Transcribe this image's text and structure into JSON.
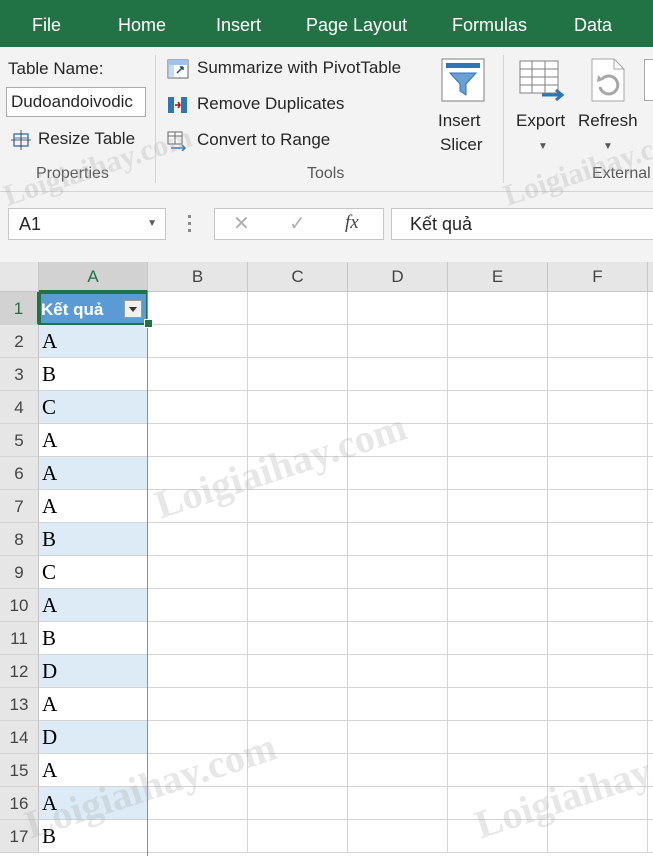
{
  "tabs": [
    "File",
    "Home",
    "Insert",
    "Page Layout",
    "Formulas",
    "Data"
  ],
  "ribbon": {
    "properties": {
      "table_name_label": "Table Name:",
      "table_name_value": "Dudoandoivodic",
      "resize_table": "Resize Table",
      "group_label": "Properties"
    },
    "tools": {
      "summarize": "Summarize with PivotTable",
      "remove_duplicates": "Remove Duplicates",
      "convert_to_range": "Convert to Range",
      "insert_slicer_line1": "Insert",
      "insert_slicer_line2": "Slicer",
      "group_label": "Tools"
    },
    "external": {
      "export": "Export",
      "refresh": "Refresh",
      "group_label": "External"
    }
  },
  "formula_bar": {
    "name_box": "A1",
    "cancel": "✕",
    "enter": "✓",
    "fx": "fx",
    "content": "Kết quả"
  },
  "columns": [
    "A",
    "B",
    "C",
    "D",
    "E",
    "F"
  ],
  "rows": [
    "1",
    "2",
    "3",
    "4",
    "5",
    "6",
    "7",
    "8",
    "9",
    "10",
    "11",
    "12",
    "13",
    "14",
    "15",
    "16",
    "17"
  ],
  "table": {
    "header": "Kết quả",
    "values": [
      "A",
      "B",
      "C",
      "A",
      "A",
      "A",
      "B",
      "C",
      "A",
      "B",
      "D",
      "A",
      "D",
      "A",
      "A",
      "B"
    ]
  },
  "watermark": "Loigiaihay.com",
  "colors": {
    "excel_green": "#217346",
    "table_header": "#5b9bd5",
    "band": "#ddebf7"
  }
}
